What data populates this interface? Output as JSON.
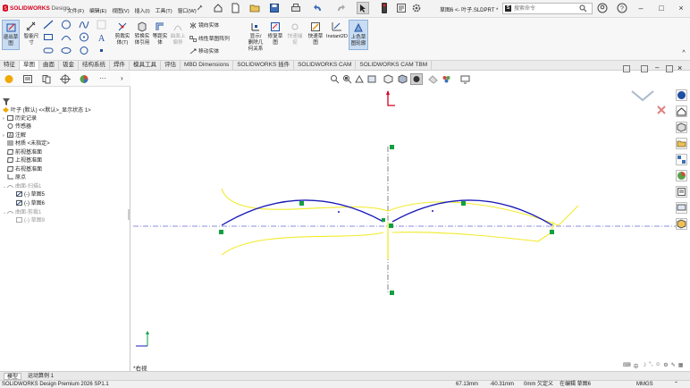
{
  "app": {
    "name": "SOLIDWORKS",
    "name_suffix": "Design"
  },
  "menu": [
    "文件(F)",
    "编辑(E)",
    "视图(V)",
    "插入(I)",
    "工具(T)",
    "窗口(W)"
  ],
  "title": "草图6 <- 叶子.SLDPRT *",
  "search": {
    "placeholder": "搜索命令"
  },
  "ribbon": {
    "exit_sketch": [
      "退出草",
      "图"
    ],
    "smart_dim": [
      "智能尺",
      "寸"
    ],
    "trim": [
      "剪裁实",
      "体(T)"
    ],
    "convert": [
      "转换实",
      "体引用"
    ],
    "offset": [
      "等距实",
      "体"
    ],
    "offset_surface": [
      "曲面上",
      "偏移"
    ],
    "mirror": "镜向实体",
    "linear_pattern": "线性草图阵列",
    "move": "移动实体",
    "display_rel": [
      "显示/",
      "删除几",
      "何关系"
    ],
    "repair": [
      "修复草",
      "图"
    ],
    "snap": [
      "快速捕",
      "捉"
    ],
    "quick_sketch": [
      "快速草",
      "图"
    ],
    "instant2d": "Instant2D",
    "shaded": [
      "上色草",
      "图轮廓"
    ]
  },
  "cm_tabs": [
    "特征",
    "草图",
    "曲面",
    "钣金",
    "结构系统",
    "焊件",
    "模具工具",
    "评估",
    "MBD Dimensions",
    "SOLIDWORKS 插件",
    "SOLIDWORKS CAM",
    "SOLIDWORKS CAM TBM"
  ],
  "tree": {
    "root": "叶子 (默认) <<默认>_显示状态 1>",
    "items": [
      {
        "label": "历史记录",
        "muted": false
      },
      {
        "label": "传感器",
        "muted": false
      },
      {
        "label": "注解",
        "muted": false
      },
      {
        "label": "材质 <未指定>",
        "muted": false
      },
      {
        "label": "前视基准面",
        "muted": false
      },
      {
        "label": "上视基准面",
        "muted": false
      },
      {
        "label": "右视基准面",
        "muted": false
      },
      {
        "label": "原点",
        "muted": false
      },
      {
        "label": "曲面-扫描1",
        "muted": true
      },
      {
        "label": "(-) 草图5",
        "muted": false
      },
      {
        "label": "(-) 草图6",
        "muted": false
      },
      {
        "label": "曲面-剪裁1",
        "muted": true
      },
      {
        "label": "(-) 草图9",
        "muted": true
      }
    ]
  },
  "viewport": {
    "view_label": "*右视"
  },
  "bottom_tabs": [
    "模型",
    "运动算例 1"
  ],
  "status": {
    "product": "SOLIDWORKS Design Premium 2026 SP1.1",
    "x": "67.13mm",
    "y": "-60.31mm",
    "z": "0mm 欠定义",
    "editing": "在编辑 草图6",
    "units": "MMGS"
  },
  "colors": {
    "accent": "#1e4fa3",
    "sketch_blue": "#1a1ab8",
    "ref_yellow": "#f2ea2a",
    "point_green": "#10a040",
    "brand_red": "#d6001c"
  }
}
